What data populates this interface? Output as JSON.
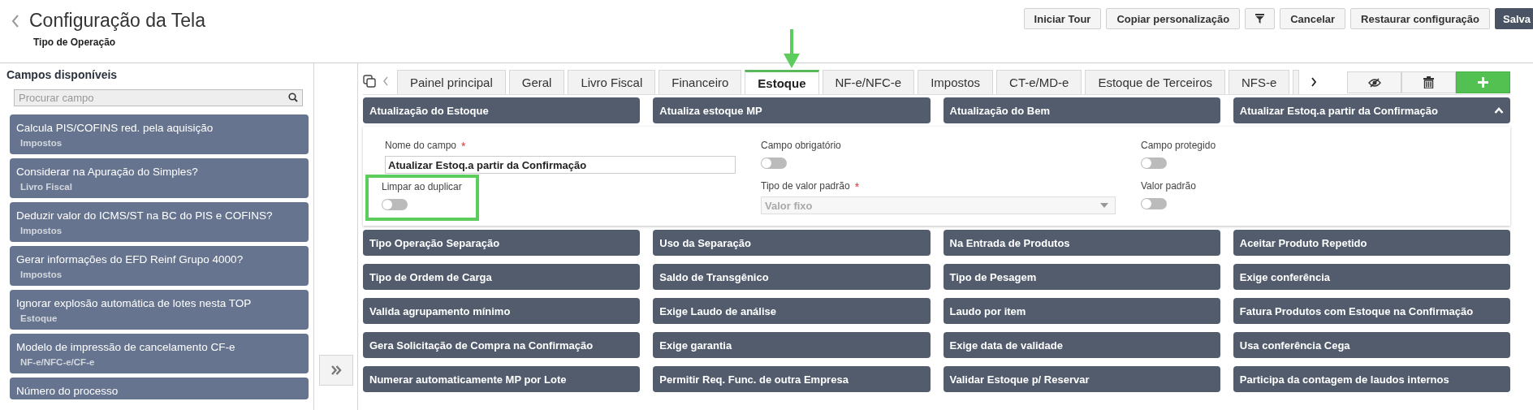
{
  "header": {
    "title": "Configuração da Tela",
    "subtitle": "Tipo de Operação",
    "buttons": [
      {
        "label": "Iniciar Tour",
        "kind": "default"
      },
      {
        "label": "Copiar personalização",
        "kind": "default"
      },
      {
        "kind": "filter"
      },
      {
        "label": "Cancelar",
        "kind": "default"
      },
      {
        "label": "Restaurar configuração",
        "kind": "default"
      },
      {
        "label": "Salva",
        "kind": "primary"
      }
    ]
  },
  "sidebar": {
    "title": "Campos disponíveis",
    "search": {
      "placeholder": "Procurar campo"
    },
    "items": [
      {
        "label": "Calcula PIS/COFINS red. pela aquisição",
        "group": "Impostos"
      },
      {
        "label": "Considerar na Apuração do Simples?",
        "group": "Livro Fiscal"
      },
      {
        "label": "Deduzir valor do ICMS/ST na BC do PIS e COFINS?",
        "group": "Impostos"
      },
      {
        "label": "Gerar informações do EFD Reinf Grupo 4000?",
        "group": "Impostos"
      },
      {
        "label": "Ignorar explosão automática de lotes nesta TOP",
        "group": "Estoque"
      },
      {
        "label": "Modelo de impressão de cancelamento CF-e",
        "group": "NF-e/NFC-e/CF-e"
      },
      {
        "label": "Número do processo"
      }
    ]
  },
  "tabs": [
    {
      "label": "Painel principal",
      "selected": false
    },
    {
      "label": "Geral",
      "selected": false
    },
    {
      "label": "Livro Fiscal",
      "selected": false
    },
    {
      "label": "Financeiro",
      "selected": false
    },
    {
      "label": "Estoque",
      "selected": true
    },
    {
      "label": "NF-e/NFC-e",
      "selected": false
    },
    {
      "label": "Impostos",
      "selected": false
    },
    {
      "label": "CT-e/MD-e",
      "selected": false
    },
    {
      "label": "Estoque de Terceiros",
      "selected": false
    },
    {
      "label": "NFS-e",
      "selected": false
    }
  ],
  "fields": [
    {
      "label": "Atualização do Estoque",
      "expanded": false
    },
    {
      "label": "Atualiza estoque MP",
      "expanded": false
    },
    {
      "label": "Atualização do Bem",
      "expanded": false
    },
    {
      "label": "Atualizar Estoq.a partir da Confirmação",
      "expanded": true
    },
    {
      "label": "Tipo Operação Separação",
      "expanded": false
    },
    {
      "label": "Uso da Separação",
      "expanded": false
    },
    {
      "label": "Na Entrada de Produtos",
      "expanded": false
    },
    {
      "label": "Aceitar Produto Repetido",
      "expanded": false
    },
    {
      "label": "Tipo de Ordem de Carga",
      "expanded": false
    },
    {
      "label": "Saldo de Transgênico",
      "expanded": false
    },
    {
      "label": "Tipo de Pesagem",
      "expanded": false
    },
    {
      "label": "Exige conferência",
      "expanded": false
    },
    {
      "label": "Valida agrupamento mínimo",
      "expanded": false
    },
    {
      "label": "Exige Laudo de análise",
      "expanded": false
    },
    {
      "label": "Laudo por item",
      "expanded": false
    },
    {
      "label": "Fatura Produtos com Estoque na Confirmação",
      "expanded": false
    },
    {
      "label": "Gera Solicitação de Compra na Confirmação",
      "expanded": false
    },
    {
      "label": "Exige garantia",
      "expanded": false
    },
    {
      "label": "Exige data de validade",
      "expanded": false
    },
    {
      "label": "Usa conferência Cega",
      "expanded": false
    },
    {
      "label": "Numerar automaticamente MP por Lote",
      "expanded": false
    },
    {
      "label": "Permitir Req. Func. de outra Empresa",
      "expanded": false
    },
    {
      "label": "Validar Estoque p/ Reservar",
      "expanded": false
    },
    {
      "label": "Participa da contagem de laudos internos",
      "expanded": false
    }
  ],
  "detail": {
    "items": [
      {
        "kind": "text",
        "label": "Nome do campo",
        "required_mark": "*",
        "value": "Atualizar Estoq.a partir da Confirmação",
        "highlighted": false
      },
      {
        "kind": "toggle",
        "label": "Campo obrigatório",
        "on": false,
        "highlighted": false
      },
      {
        "kind": "toggle",
        "label": "Campo protegido",
        "on": false,
        "highlighted": false
      },
      {
        "kind": "toggle",
        "label": "Limpar ao duplicar",
        "on": false,
        "highlighted": true
      },
      {
        "kind": "select",
        "label": "Tipo de valor padrão",
        "required_mark": "*",
        "value": "Valor fixo",
        "disabled": true,
        "highlighted": false
      },
      {
        "kind": "toggle",
        "label": "Valor padrão",
        "on": false,
        "highlighted": false
      }
    ]
  }
}
